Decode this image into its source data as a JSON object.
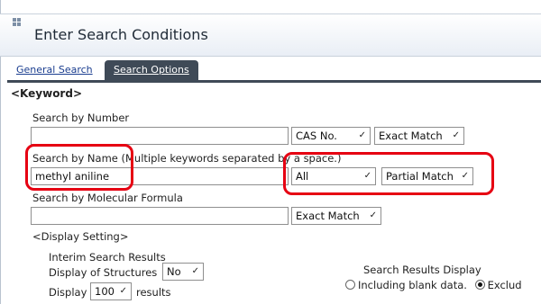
{
  "header": {
    "title": "Enter Search Conditions"
  },
  "tabs": {
    "general": "General Search",
    "options": "Search Options"
  },
  "keyword": {
    "section_title": "<Keyword>",
    "by_number": {
      "label": "Search by Number",
      "value": "",
      "type_select": "CAS No.",
      "match_select": "Exact Match"
    },
    "by_name": {
      "label": "Search by Name (Multiple keywords separated by a space.)",
      "value": "methyl aniline",
      "scope_select": "All",
      "match_select": "Partial Match"
    },
    "by_formula": {
      "label": "Search by Molecular Formula",
      "value": "",
      "match_select": "Exact Match"
    }
  },
  "display": {
    "section_title": "<Display Setting>",
    "interim_title": "Interim Search Results",
    "structures_label": "Display of Structures",
    "structures_value": "No",
    "display_label": "Display",
    "display_count": "100",
    "results_label": "results",
    "search_results_display_label": "Search Results Display",
    "option_including": "Including blank data.",
    "option_excluding": "Exclud",
    "selected_option": "excluding"
  },
  "colors": {
    "highlight": "#e60012",
    "tab_active": "#3f4a57",
    "link": "#1a3d8f"
  }
}
